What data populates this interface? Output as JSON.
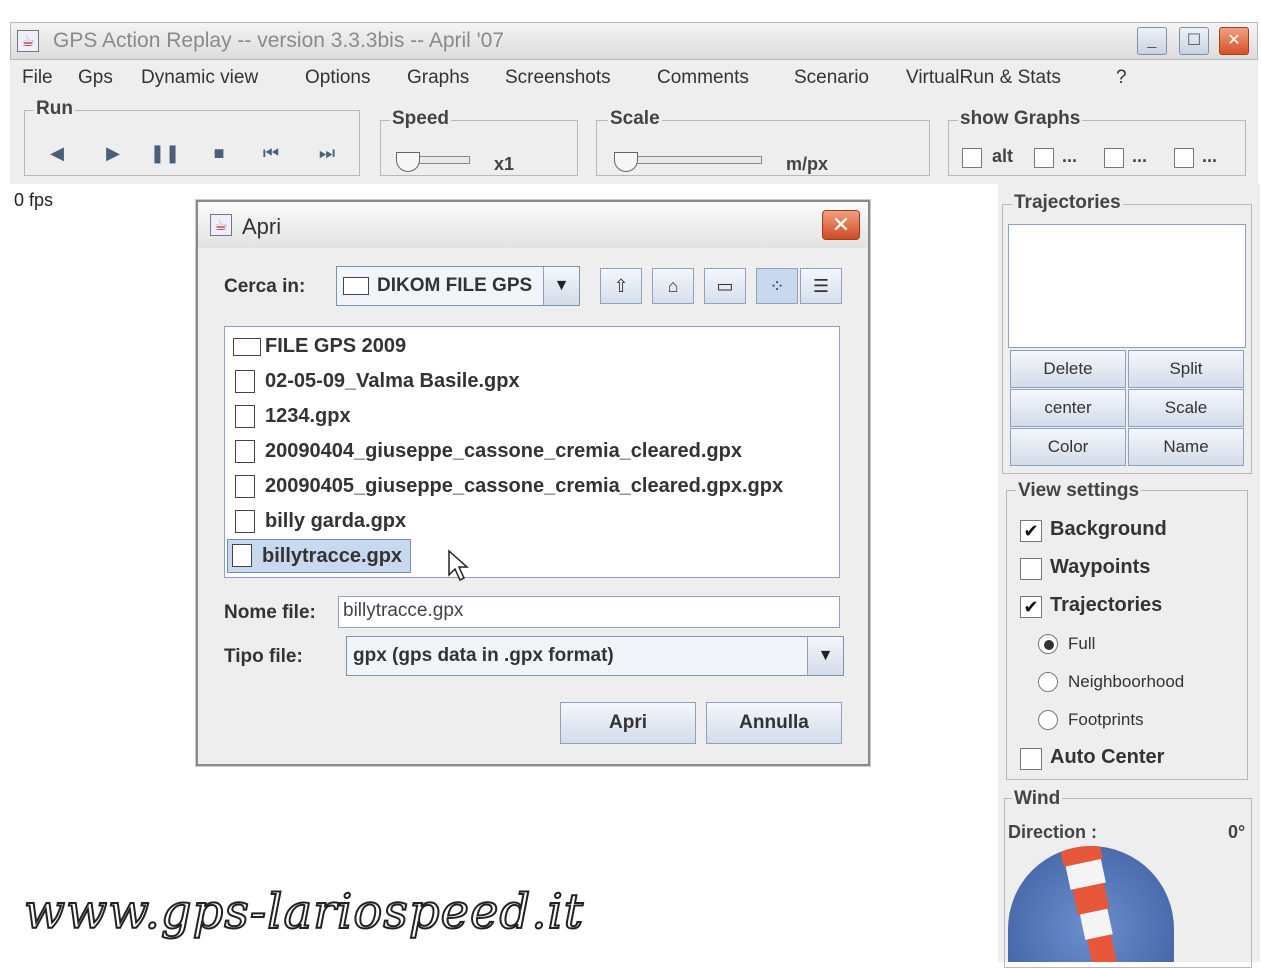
{
  "window": {
    "title": "GPS Action Replay -- version 3.3.3bis -- April '07"
  },
  "menu": [
    "File",
    "Gps",
    "Dynamic view",
    "Options",
    "Graphs",
    "Screenshots",
    "Comments",
    "Scenario",
    "VirtualRun & Stats",
    "?"
  ],
  "toolbar": {
    "run_label": "Run",
    "speed_label": "Speed",
    "speed_value": "x1",
    "scale_label": "Scale",
    "scale_unit": "m/px",
    "graphs_label": "show Graphs",
    "graphs_alt": "alt",
    "graphs_more": "..."
  },
  "canvas": {
    "fps": "0 fps"
  },
  "right_panel": {
    "trajectories_label": "Trajectories",
    "buttons": [
      "Delete",
      "Split",
      "center",
      "Scale",
      "Color",
      "Name"
    ],
    "view_settings_label": "View settings",
    "background": "Background",
    "waypoints": "Waypoints",
    "trajectories": "Trajectories",
    "full": "Full",
    "neighboorhood": "Neighboorhood",
    "footprints": "Footprints",
    "auto_center": "Auto Center",
    "wind_label": "Wind",
    "direction_label": "Direction :",
    "direction_value": "0°"
  },
  "dialog": {
    "title": "Apri",
    "look_in_label": "Cerca in:",
    "look_in_value": "DIKOM FILE GPS",
    "files": [
      "FILE GPS 2009",
      "02-05-09_Valma Basile.gpx",
      "1234.gpx",
      "20090404_giuseppe_cassone_cremia_cleared.gpx",
      "20090405_giuseppe_cassone_cremia_cleared.gpx.gpx",
      "billy garda.gpx",
      "billytracce.gpx"
    ],
    "filename_label": "Nome file:",
    "filename_value": "billytracce.gpx",
    "filetype_label": "Tipo file:",
    "filetype_value": "gpx (gps data in .gpx format)",
    "open_button": "Apri",
    "cancel_button": "Annulla"
  },
  "watermark": "www.gps-lariospeed.it",
  "colors": {
    "selection": "#c8d8ee",
    "close_red": "#d8502a",
    "button_border": "#8ea2bf"
  }
}
